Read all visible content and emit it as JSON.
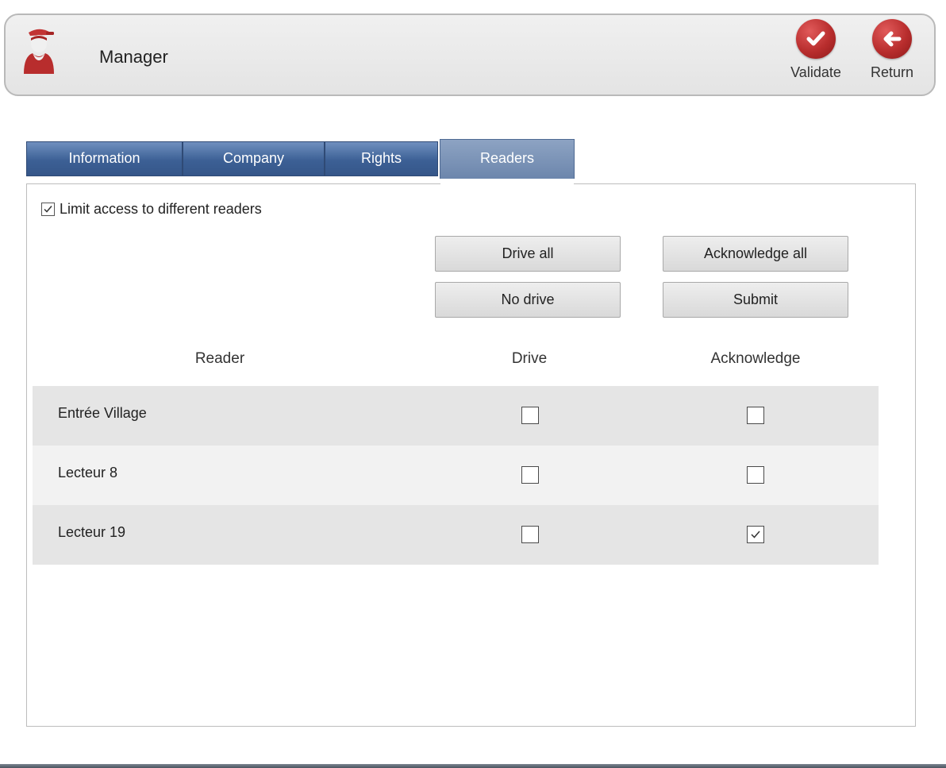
{
  "header": {
    "title": "Manager",
    "avatar_icon": "user-manager-icon",
    "actions": {
      "validate_label": "Validate",
      "return_label": "Return"
    },
    "accent_color": "#b82d2d"
  },
  "tabs": {
    "information": "Information",
    "company": "Company",
    "rights": "Rights",
    "readers": "Readers",
    "active": "Readers"
  },
  "readers_panel": {
    "limit_access_label": "Limit access to different readers",
    "limit_access_checked": true,
    "buttons": {
      "drive_all": "Drive all",
      "no_drive": "No drive",
      "acknowledge_all": "Acknowledge all",
      "submit": "Submit"
    },
    "columns": {
      "reader": "Reader",
      "drive": "Drive",
      "acknowledge": "Acknowledge"
    },
    "rows": [
      {
        "name": "Entrée Village",
        "drive": false,
        "acknowledge": false
      },
      {
        "name": "Lecteur 8",
        "drive": false,
        "acknowledge": false
      },
      {
        "name": "Lecteur 19",
        "drive": false,
        "acknowledge": true
      }
    ]
  },
  "colors": {
    "tab_active": "#6c86ac",
    "tab_inactive": "#3c6095",
    "row_dark": "#e5e5e5",
    "row_light": "#f2f2f2"
  }
}
